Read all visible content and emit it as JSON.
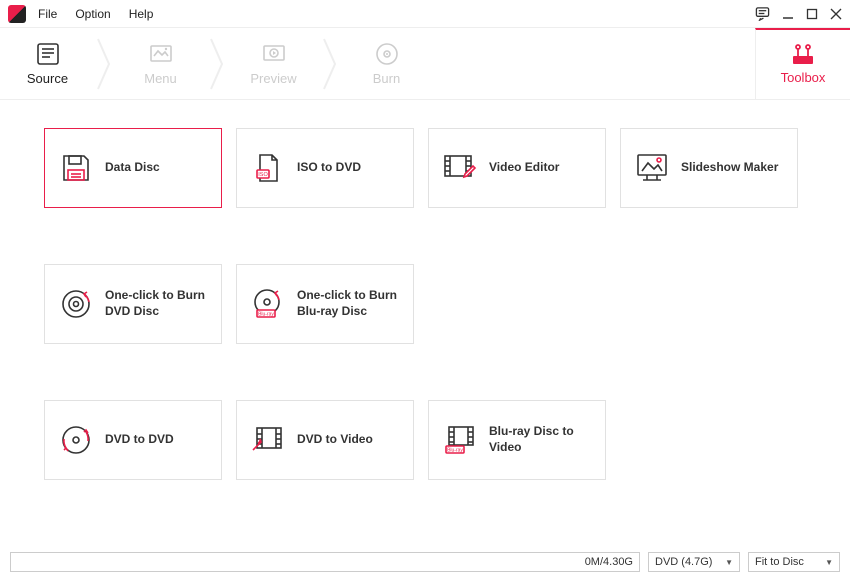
{
  "menu": {
    "file": "File",
    "option": "Option",
    "help": "Help"
  },
  "steps": {
    "source": "Source",
    "menu": "Menu",
    "preview": "Preview",
    "burn": "Burn",
    "toolbox": "Toolbox"
  },
  "tiles": {
    "data_disc": "Data Disc",
    "iso_to_dvd": "ISO to DVD",
    "video_editor": "Video Editor",
    "slideshow_maker": "Slideshow Maker",
    "one_click_dvd": "One-click to Burn DVD Disc",
    "one_click_bluray": "One-click to Burn Blu-ray Disc",
    "dvd_to_dvd": "DVD to DVD",
    "dvd_to_video": "DVD to Video",
    "bluray_to_video": "Blu-ray Disc to Video"
  },
  "footer": {
    "progress": "0M/4.30G",
    "disc_type": "DVD (4.7G)",
    "fit": "Fit to Disc"
  }
}
